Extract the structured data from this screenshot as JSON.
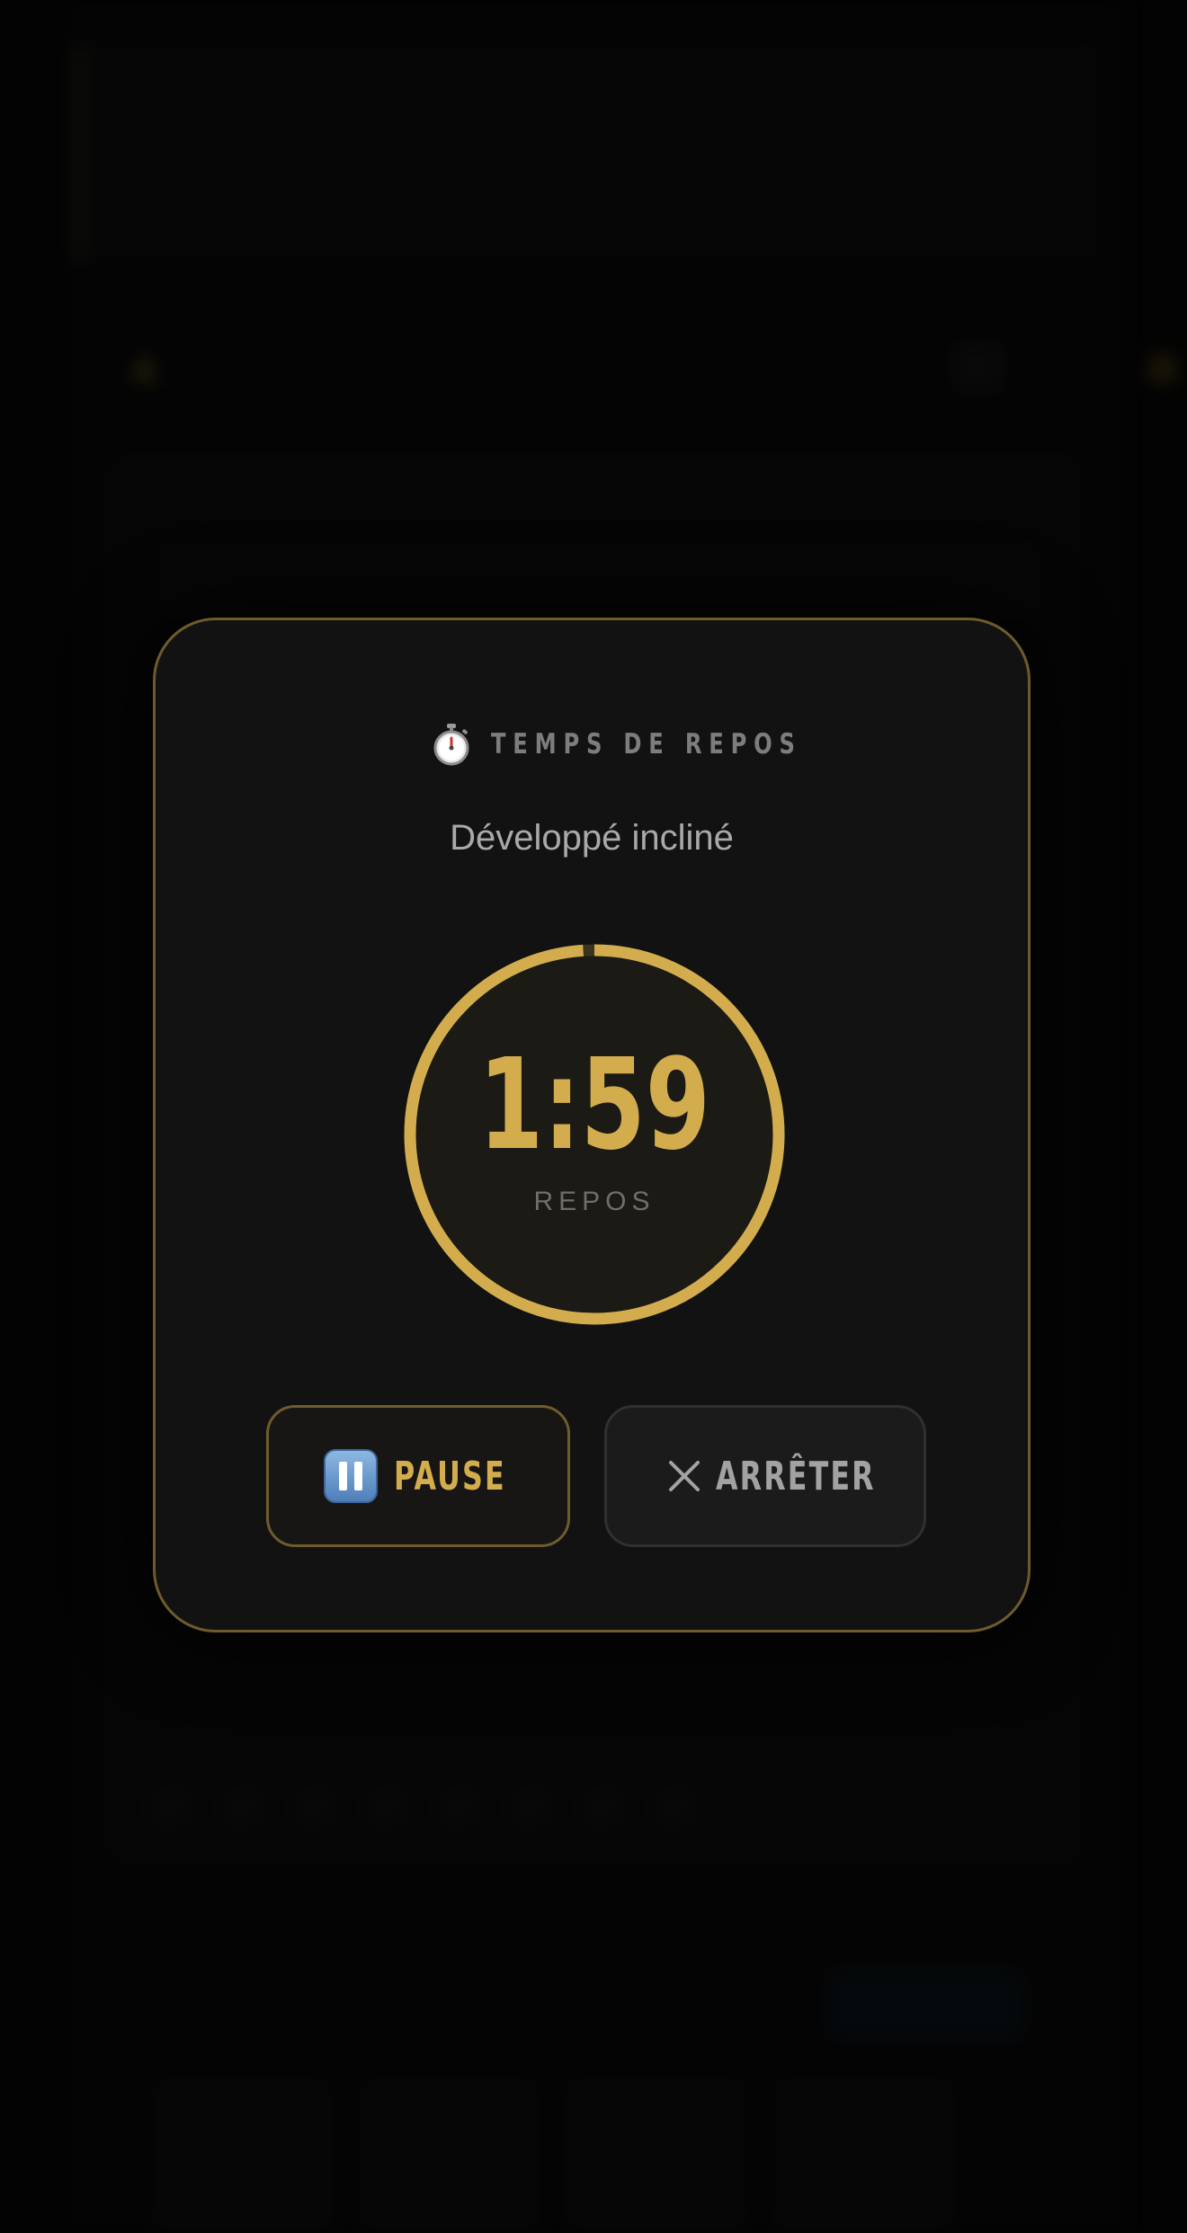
{
  "background": {
    "note_text": "",
    "header_title": "",
    "alert_text": "",
    "exercise_title": ""
  },
  "modal": {
    "icon": "stopwatch-icon",
    "title": "TEMPS DE REPOS",
    "exercise": "Développé incliné",
    "timer": {
      "value": "1:59",
      "label": "REPOS",
      "progress": 0.99
    },
    "buttons": {
      "pause": {
        "icon": "pause-icon",
        "label": "PAUSE"
      },
      "stop": {
        "icon": "close-icon",
        "label": "ARRÊTER"
      }
    }
  },
  "colors": {
    "accent": "#d3ad4d",
    "modal_bg": "#121212",
    "modal_border": "#6e5b2c",
    "muted_text": "#7d7d7d",
    "pause_icon_blue": "#5b8fc9"
  }
}
